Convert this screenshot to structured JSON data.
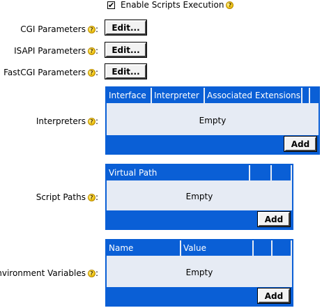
{
  "scripts": {
    "enable_label": "Enable Scripts Execution",
    "enable_checked": true,
    "check_mark": "✔"
  },
  "params": [
    {
      "label": "CGI Parameters",
      "button": "Edit..."
    },
    {
      "label": "ISAPI Parameters",
      "button": "Edit..."
    },
    {
      "label": "FastCGI Parameters",
      "button": "Edit..."
    }
  ],
  "help_glyph": "?",
  "label_suffix": ":",
  "interpreters": {
    "label": "Interpreters",
    "columns": [
      "Interface",
      "Interpreter",
      "Associated Extensions",
      ""
    ],
    "empty_text": "Empty",
    "add_button": "Add"
  },
  "script_paths": {
    "label": "Script Paths",
    "columns": [
      "Virtual Path",
      "",
      ""
    ],
    "empty_text": "Empty",
    "add_button": "Add"
  },
  "env_vars": {
    "label": "Environment Variables",
    "columns": [
      "Name",
      "Value",
      "",
      ""
    ],
    "empty_text": "Empty",
    "add_button": "Add"
  },
  "colors": {
    "table_accent": "#0a5fd6",
    "table_body": "#e6ebf4",
    "help_icon": "#f5cc1a"
  }
}
